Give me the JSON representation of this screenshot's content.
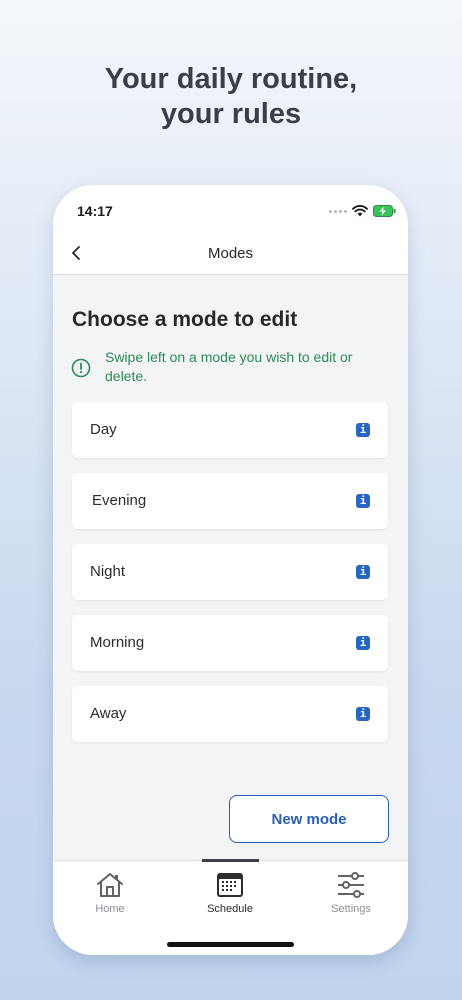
{
  "headline": {
    "line1": "Your daily routine,",
    "line2": "your rules"
  },
  "status_bar": {
    "time": "14:17"
  },
  "nav": {
    "title": "Modes",
    "back_icon": "chevron-left-icon"
  },
  "page": {
    "title": "Choose a mode to edit",
    "hint": "Swipe left on a mode you wish to edit or delete.",
    "hint_color": "#2c8a55"
  },
  "modes": [
    {
      "label": "Day",
      "info": "i"
    },
    {
      "label": "Evening",
      "info": "i"
    },
    {
      "label": "Night",
      "info": "i"
    },
    {
      "label": "Morning",
      "info": "i"
    },
    {
      "label": "Away",
      "info": "i"
    }
  ],
  "new_mode_label": "New mode",
  "accent_color": "#2a5fb0",
  "tabs": [
    {
      "label": "Home",
      "icon": "home-icon",
      "active": false
    },
    {
      "label": "Schedule",
      "icon": "calendar-icon",
      "active": true
    },
    {
      "label": "Settings",
      "icon": "sliders-icon",
      "active": false
    }
  ]
}
